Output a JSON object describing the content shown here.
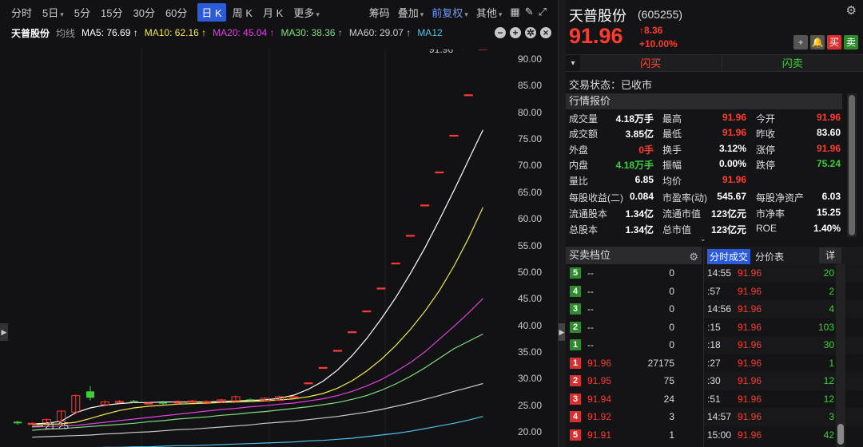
{
  "toolbar": {
    "items": [
      "分时",
      "5日",
      "5分",
      "15分",
      "30分",
      "60分",
      "日 K",
      "周 K",
      "月 K",
      "更多"
    ],
    "active": "日 K",
    "right": [
      "筹码",
      "叠加",
      "前复权",
      "其他"
    ]
  },
  "ma_bar": {
    "name": "天普股份",
    "mode": "均线",
    "ma5": "MA5: 76.69 ↑",
    "ma10": "MA10: 62.16 ↑",
    "ma20": "MA20: 45.04 ↑",
    "ma30": "MA30: 38.36 ↑",
    "ma60": "MA60: 29.07 ↑",
    "ma12": "MA12",
    "colors": {
      "ma5": "#ffffff",
      "ma10": "#f2e94e",
      "ma20": "#e040e0",
      "ma30": "#7fe07f",
      "ma60": "#cccccc",
      "ma12": "#4fc3e8"
    }
  },
  "chart_data": {
    "type": "candlestick",
    "y_ticks": [
      "90.00",
      "85.00",
      "80.00",
      "75.00",
      "70.00",
      "65.00",
      "60.00",
      "55.00",
      "50.00",
      "45.00",
      "40.00",
      "35.00",
      "30.00",
      "25.00",
      "20.00"
    ],
    "ylim": [
      20,
      90
    ],
    "high_label": "91.96",
    "low_label": "21.25",
    "candles": [
      {
        "o": 21.6,
        "c": 21.9,
        "h": 22.1,
        "l": 21.3,
        "up": false
      },
      {
        "o": 21.4,
        "c": 21.6,
        "h": 21.8,
        "l": 21.25,
        "up": true
      },
      {
        "o": 21.7,
        "c": 22.3,
        "h": 22.5,
        "l": 21.5,
        "up": true
      },
      {
        "o": 22.0,
        "c": 23.9,
        "h": 24.0,
        "l": 21.9,
        "up": true
      },
      {
        "o": 23.7,
        "c": 26.8,
        "h": 27.0,
        "l": 23.6,
        "up": true
      },
      {
        "o": 27.6,
        "c": 26.4,
        "h": 28.6,
        "l": 25.9,
        "up": false
      },
      {
        "o": 25.1,
        "c": 25.6,
        "h": 25.9,
        "l": 24.8,
        "up": true
      },
      {
        "o": 25.6,
        "c": 25.7,
        "h": 26.0,
        "l": 25.3,
        "up": true
      },
      {
        "o": 25.8,
        "c": 25.7,
        "h": 26.0,
        "l": 25.4,
        "up": false
      },
      {
        "o": 25.3,
        "c": 25.4,
        "h": 25.6,
        "l": 25.1,
        "up": true
      },
      {
        "o": 25.5,
        "c": 25.3,
        "h": 25.8,
        "l": 25.1,
        "up": false
      },
      {
        "o": 25.4,
        "c": 25.7,
        "h": 25.9,
        "l": 25.2,
        "up": true
      },
      {
        "o": 25.6,
        "c": 25.8,
        "h": 26.0,
        "l": 25.4,
        "up": true
      },
      {
        "o": 25.7,
        "c": 25.7,
        "h": 25.9,
        "l": 25.5,
        "up": true
      },
      {
        "o": 25.6,
        "c": 26.0,
        "h": 26.2,
        "l": 25.4,
        "up": true
      },
      {
        "o": 25.8,
        "c": 26.6,
        "h": 26.8,
        "l": 25.6,
        "up": true
      },
      {
        "o": 26.1,
        "c": 26.0,
        "h": 26.3,
        "l": 25.8,
        "up": false
      },
      {
        "o": 25.9,
        "c": 26.3,
        "h": 26.5,
        "l": 25.7,
        "up": true
      },
      {
        "o": 25.9,
        "c": 26.6,
        "h": 26.8,
        "l": 25.8,
        "up": true
      },
      {
        "o": 26.6,
        "c": 26.6,
        "h": 26.6,
        "l": 26.6,
        "up": true
      },
      {
        "o": 29.2,
        "c": 29.2,
        "h": 29.2,
        "l": 29.2,
        "up": true
      },
      {
        "o": 32.1,
        "c": 32.1,
        "h": 32.1,
        "l": 32.1,
        "up": true
      },
      {
        "o": 35.3,
        "c": 35.3,
        "h": 35.3,
        "l": 35.3,
        "up": true
      },
      {
        "o": 38.8,
        "c": 38.8,
        "h": 38.8,
        "l": 38.8,
        "up": true
      },
      {
        "o": 42.7,
        "c": 42.7,
        "h": 42.7,
        "l": 42.7,
        "up": true
      },
      {
        "o": 47.0,
        "c": 47.0,
        "h": 47.0,
        "l": 47.0,
        "up": true
      },
      {
        "o": 51.7,
        "c": 51.7,
        "h": 51.7,
        "l": 51.7,
        "up": true
      },
      {
        "o": 56.9,
        "c": 56.9,
        "h": 56.9,
        "l": 56.9,
        "up": true
      },
      {
        "o": 62.6,
        "c": 62.6,
        "h": 62.6,
        "l": 62.6,
        "up": true
      },
      {
        "o": 68.8,
        "c": 68.8,
        "h": 68.8,
        "l": 68.8,
        "up": true
      },
      {
        "o": 75.7,
        "c": 75.7,
        "h": 75.7,
        "l": 75.7,
        "up": true
      },
      {
        "o": 83.3,
        "c": 83.3,
        "h": 83.3,
        "l": 83.3,
        "up": true
      },
      {
        "o": 91.96,
        "c": 91.96,
        "h": 91.96,
        "l": 91.96,
        "up": true
      }
    ],
    "ma_series": [
      {
        "name": "MA5",
        "color": "#ffffff",
        "values": [
          21.5,
          21.6,
          22.0,
          23.6,
          24.5,
          25.0,
          25.3,
          25.5,
          25.5,
          25.6,
          25.6,
          25.6,
          25.6,
          25.7,
          25.8,
          25.9,
          26.0,
          26.3,
          26.9,
          28.0,
          29.5,
          31.6,
          34.3,
          37.5,
          41.2,
          45.2,
          49.7,
          54.5,
          59.8,
          65.3,
          71.0,
          76.69
        ]
      },
      {
        "name": "MA10",
        "color": "#f2e94e",
        "values": [
          21.3,
          21.4,
          21.5,
          21.8,
          22.5,
          23.3,
          24.0,
          24.5,
          24.8,
          25.0,
          25.2,
          25.3,
          25.4,
          25.5,
          25.6,
          25.7,
          25.8,
          26.0,
          26.2,
          26.6,
          27.2,
          28.2,
          29.6,
          31.4,
          33.6,
          36.2,
          39.2,
          42.6,
          46.5,
          51.1,
          56.3,
          62.16
        ]
      },
      {
        "name": "MA20",
        "color": "#e040e0",
        "values": [
          20.9,
          21.0,
          21.1,
          21.2,
          21.5,
          21.8,
          22.1,
          22.4,
          22.7,
          23.0,
          23.3,
          23.6,
          23.9,
          24.2,
          24.4,
          24.7,
          24.9,
          25.2,
          25.4,
          25.8,
          26.2,
          26.8,
          27.6,
          28.6,
          29.8,
          31.3,
          33.0,
          35.0,
          37.4,
          39.8,
          42.3,
          45.04
        ]
      },
      {
        "name": "MA30",
        "color": "#7fe07f",
        "values": [
          20.3,
          20.5,
          20.6,
          20.8,
          21.0,
          21.2,
          21.4,
          21.6,
          21.9,
          22.1,
          22.4,
          22.6,
          22.8,
          23.1,
          23.3,
          23.6,
          23.8,
          24.1,
          24.4,
          24.7,
          25.1,
          25.5,
          26.1,
          26.8,
          27.8,
          29.0,
          30.4,
          32.0,
          33.8,
          35.6,
          37.0,
          38.36
        ]
      },
      {
        "name": "MA60",
        "color": "#cccccc",
        "values": [
          19.0,
          19.1,
          19.2,
          19.3,
          19.4,
          19.6,
          19.7,
          19.9,
          20.0,
          20.2,
          20.4,
          20.5,
          20.7,
          20.9,
          21.1,
          21.3,
          21.6,
          21.8,
          22.0,
          22.3,
          22.6,
          22.9,
          23.3,
          23.7,
          24.2,
          24.8,
          25.4,
          26.1,
          26.8,
          27.6,
          28.3,
          29.07
        ]
      },
      {
        "name": "MA12",
        "color": "#4fc3e8",
        "values": [
          16.8,
          16.9,
          16.9,
          17.0,
          17.0,
          17.1,
          17.1,
          17.2,
          17.2,
          17.3,
          17.4,
          17.4,
          17.5,
          17.6,
          17.7,
          17.8,
          17.9,
          18.0,
          18.1,
          18.3,
          18.4,
          18.6,
          18.8,
          19.1,
          19.4,
          19.7,
          20.1,
          20.6,
          21.1,
          21.6,
          22.2,
          22.9
        ]
      }
    ]
  },
  "header": {
    "name": "天普股份",
    "code": "(605255)",
    "price": "91.96",
    "change": "8.36",
    "pct": "+10.00%",
    "btn_add": "+",
    "btn_bell": "🔔",
    "btn_sell": "买",
    "btn_buy": "卖"
  },
  "flash": {
    "buy": "闪买",
    "sell": "闪卖",
    "arrow": "▾"
  },
  "status": "交易状态：已收市",
  "quote_title": "行情报价",
  "quotes": [
    [
      [
        "成交量",
        "4.18万手",
        "w"
      ],
      [
        "最高",
        "91.96",
        "r"
      ],
      [
        "今开",
        "91.96",
        "r"
      ]
    ],
    [
      [
        "成交额",
        "3.85亿",
        "w"
      ],
      [
        "最低",
        "91.96",
        "r"
      ],
      [
        "昨收",
        "83.60",
        "w"
      ]
    ],
    [
      [
        "外盘",
        "0手",
        "r"
      ],
      [
        "换手",
        "3.12%",
        "w"
      ],
      [
        "涨停",
        "91.96",
        "r"
      ]
    ],
    [
      [
        "内盘",
        "4.18万手",
        "g"
      ],
      [
        "振幅",
        "0.00%",
        "w"
      ],
      [
        "跌停",
        "75.24",
        "g"
      ]
    ],
    [
      [
        "量比",
        "6.85",
        "w"
      ],
      [
        "均价",
        "91.96",
        "r"
      ],
      [
        "",
        "",
        " "
      ]
    ],
    [
      [
        "每股收益(二)",
        "0.084",
        "w"
      ],
      [
        "市盈率(动)",
        "545.67",
        "w"
      ],
      [
        "每股净资产",
        "6.03",
        "w"
      ]
    ],
    [
      [
        "流通股本",
        "1.34亿",
        "w"
      ],
      [
        "流通市值",
        "123亿元",
        "w"
      ],
      [
        "市净率",
        "15.25",
        "w"
      ]
    ],
    [
      [
        "总股本",
        "1.34亿",
        "w"
      ],
      [
        "总市值",
        "123亿元",
        "w"
      ],
      [
        "ROE",
        "1.40%",
        "w"
      ]
    ]
  ],
  "orderbook": {
    "title": "买卖档位",
    "asks": [
      {
        "lvl": "5",
        "price": "--",
        "vol": "0"
      },
      {
        "lvl": "4",
        "price": "--",
        "vol": "0"
      },
      {
        "lvl": "3",
        "price": "--",
        "vol": "0"
      },
      {
        "lvl": "2",
        "price": "--",
        "vol": "0"
      },
      {
        "lvl": "1",
        "price": "--",
        "vol": "0"
      }
    ],
    "bids": [
      {
        "lvl": "1",
        "price": "91.96",
        "vol": "27175"
      },
      {
        "lvl": "2",
        "price": "91.95",
        "vol": "75"
      },
      {
        "lvl": "3",
        "price": "91.94",
        "vol": "24"
      },
      {
        "lvl": "4",
        "price": "91.92",
        "vol": "3"
      },
      {
        "lvl": "5",
        "price": "91.91",
        "vol": "1"
      }
    ]
  },
  "trades": {
    "tab1": "分时成交",
    "tab2": "分价表",
    "tab3": "详",
    "rows": [
      {
        "t": "14:55",
        "p": "91.96",
        "v": "20"
      },
      {
        "t": ":57",
        "p": "91.96",
        "v": "2"
      },
      {
        "t": "14:56",
        "p": "91.96",
        "v": "4"
      },
      {
        "t": ":15",
        "p": "91.96",
        "v": "103"
      },
      {
        "t": ":18",
        "p": "91.96",
        "v": "30"
      },
      {
        "t": ":27",
        "p": "91.96",
        "v": "1"
      },
      {
        "t": ":30",
        "p": "91.96",
        "v": "12"
      },
      {
        "t": ":51",
        "p": "91.96",
        "v": "12"
      },
      {
        "t": "14:57",
        "p": "91.96",
        "v": "3"
      },
      {
        "t": "15:00",
        "p": "91.96",
        "v": "42"
      }
    ]
  }
}
